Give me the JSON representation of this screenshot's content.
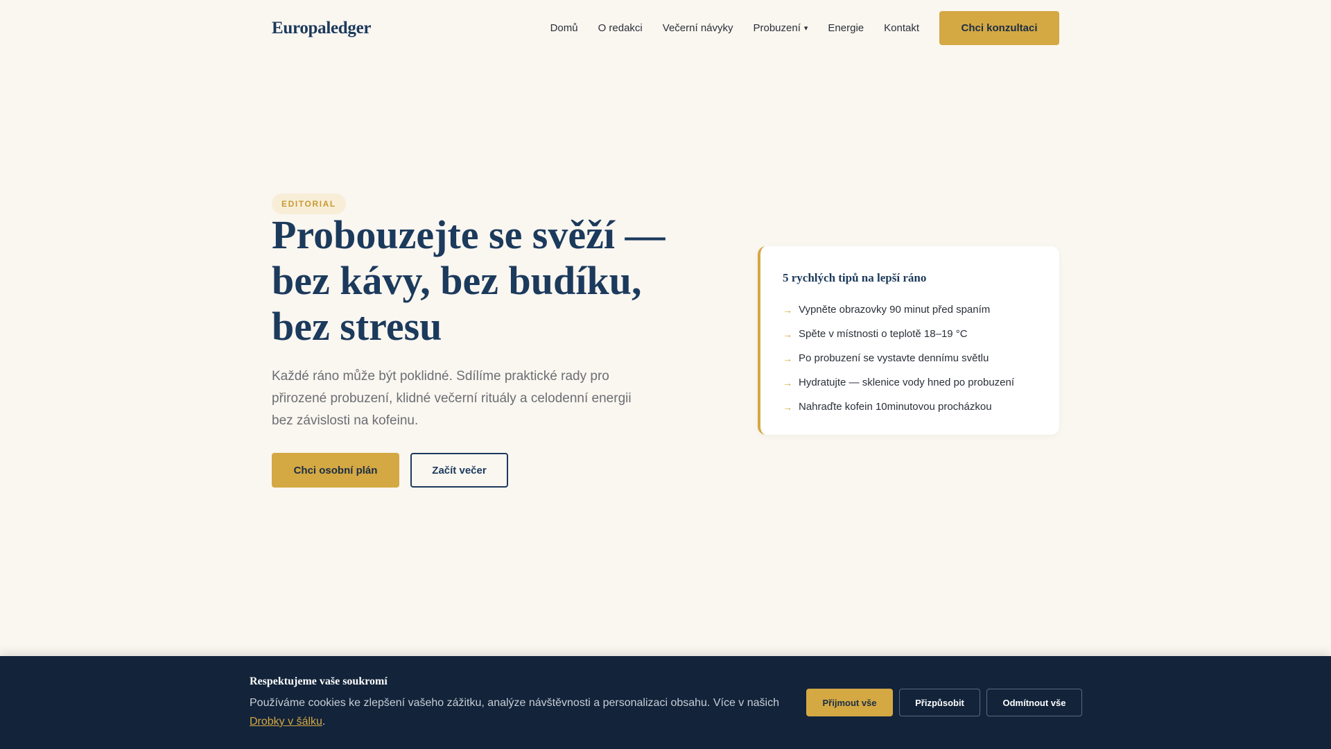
{
  "header": {
    "logo": "Europaledger",
    "nav": [
      {
        "label": "Domů"
      },
      {
        "label": "O redakci"
      },
      {
        "label": "Večerní návyky"
      },
      {
        "label": "Probuzení",
        "caret": "▾"
      },
      {
        "label": "Energie"
      },
      {
        "label": "Kontakt"
      }
    ],
    "cta": "Chci konzultaci"
  },
  "hero": {
    "badge": "EDITORIAL",
    "title_lines": [
      "Probouzejte se svěží —",
      "bez kávy, bez budíku,",
      "bez stresu"
    ],
    "subtitle": "Každé ráno může být poklidné. Sdílíme praktické rady pro přirozené probuzení, klidné večerní rituály a celodenní energii bez závislosti na kofeinu.",
    "primary_button": "Chci osobní plán",
    "secondary_button": "Začít večer"
  },
  "tips": {
    "title": "5 rychlých tipů na lepší ráno",
    "arrow": "→",
    "items": [
      "Vypněte obrazovky 90 minut před spaním",
      "Spěte v místnosti o teplotě 18–19 °C",
      "Po probuzení se vystavte dennímu světlu",
      "Hydratujte — sklenice vody hned po probuzení",
      "Nahraďte kofein 10minutovou procházkou"
    ]
  },
  "cookie": {
    "title": "Respektujeme vaše soukromí",
    "body_text": "Používáme cookies ke zlepšení vašeho zážitku, analýze návštěvnosti a personalizaci obsahu. Více v našich",
    "link_text": "Drobky v šálku",
    "trailing": ".",
    "accept": "Přijmout vše",
    "customize": "Přizpůsobit",
    "reject": "Odmítnout vše"
  },
  "colors": {
    "background": "#faf6f0",
    "navy": "#1b3a5c",
    "gold": "#d4a843",
    "banner": "#12233a"
  }
}
